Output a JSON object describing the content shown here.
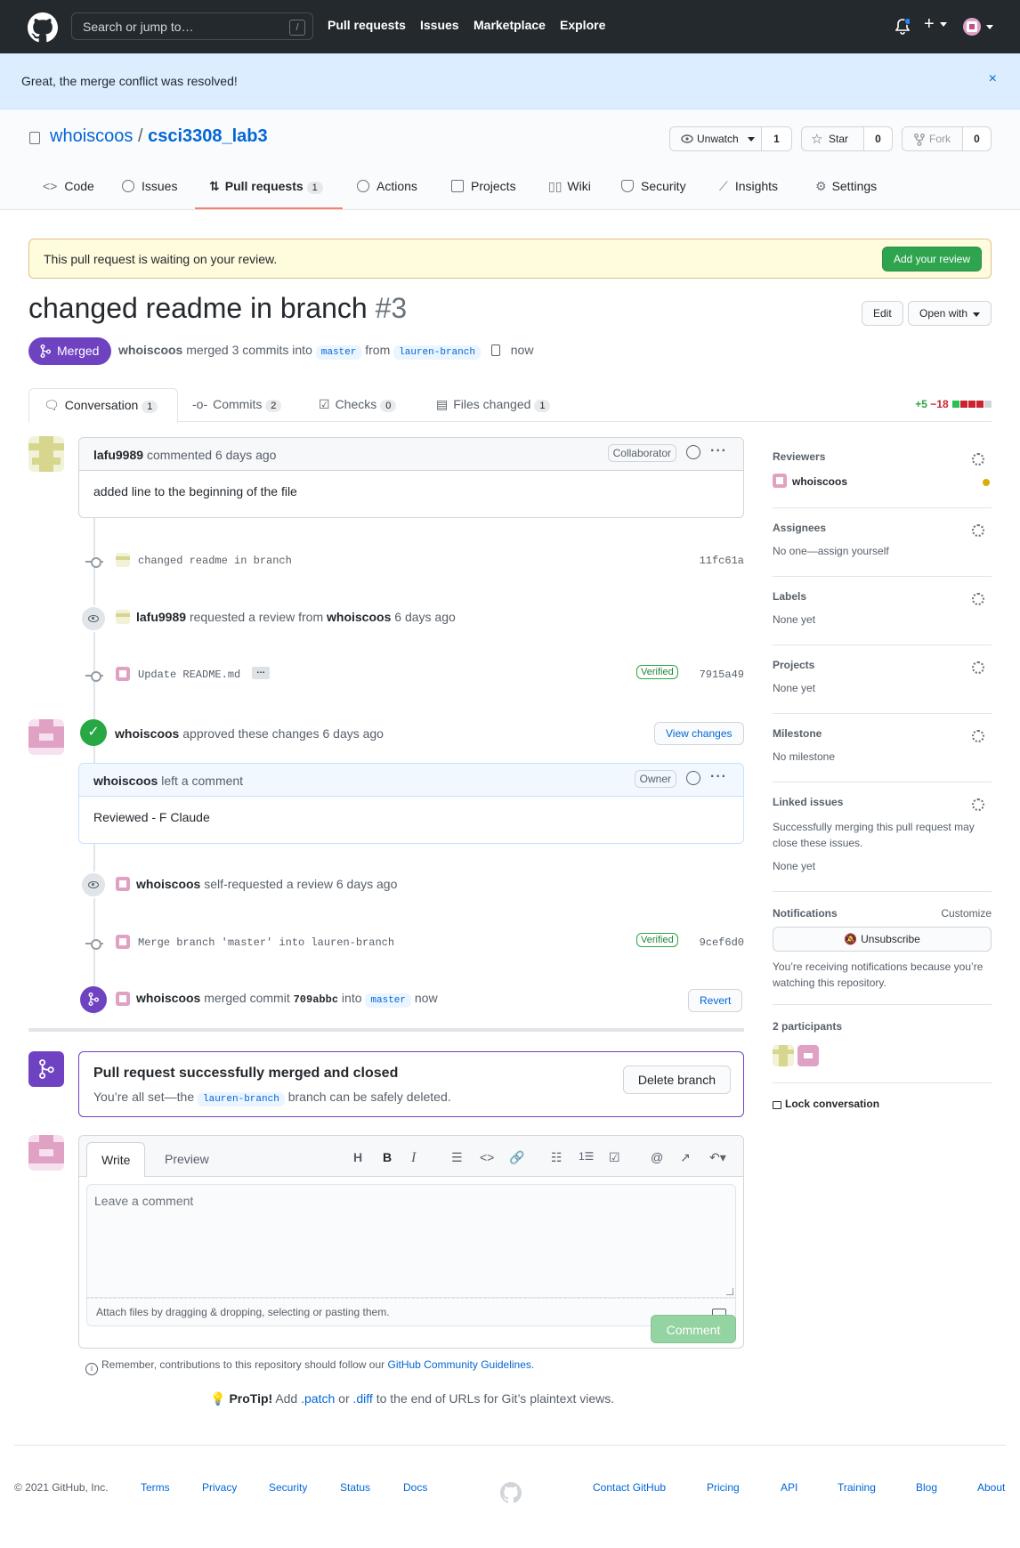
{
  "header": {
    "search_placeholder": "Search or jump to…",
    "search_key": "/",
    "nav": [
      "Pull requests",
      "Issues",
      "Marketplace",
      "Explore"
    ],
    "plus": "+"
  },
  "flash": {
    "message": "Great, the merge conflict was resolved!",
    "close": "×"
  },
  "repo": {
    "owner": "whoiscoos",
    "sep": "/",
    "name": "csci3308_lab3",
    "watch_label": "Unwatch",
    "watch_count": "1",
    "star_label": "Star",
    "star_count": "0",
    "fork_label": "Fork",
    "fork_count": "0",
    "tabs": [
      {
        "label": "Code"
      },
      {
        "label": "Issues"
      },
      {
        "label": "Pull requests",
        "count": "1"
      },
      {
        "label": "Actions"
      },
      {
        "label": "Projects"
      },
      {
        "label": "Wiki"
      },
      {
        "label": "Security"
      },
      {
        "label": "Insights"
      },
      {
        "label": "Settings"
      }
    ]
  },
  "review_banner": {
    "message": "This pull request is waiting on your review.",
    "button": "Add your review"
  },
  "pr": {
    "title": "changed readme in branch",
    "number": "#3",
    "edit": "Edit",
    "open_with": "Open with",
    "state": "Merged",
    "author": "whoiscoos",
    "meta_merged": "merged 3 commits into",
    "base": "master",
    "from": "from",
    "head": "lauren-branch",
    "time": "now",
    "tabs": [
      {
        "label": "Conversation",
        "count": "1"
      },
      {
        "label": "Commits",
        "count": "2"
      },
      {
        "label": "Checks",
        "count": "0"
      },
      {
        "label": "Files changed",
        "count": "1"
      }
    ],
    "additions": "+5",
    "deletions": "−18"
  },
  "timeline": {
    "c1": {
      "author": "lafu9989",
      "action": "commented 6 days ago",
      "role": "Collaborator",
      "body": "added line to the beginning of the file"
    },
    "commit1": {
      "message": "changed readme in branch",
      "sha": "11fc61a"
    },
    "review_req": {
      "user": "lafu9989",
      "text": "requested a review from",
      "target": "whoiscoos",
      "time": "6 days ago"
    },
    "commit2": {
      "message": "Update README.md",
      "ellipsis": "…",
      "verified": "Verified",
      "sha": "7915a49"
    },
    "approve": {
      "user": "whoiscoos",
      "text": "approved these changes 6 days ago",
      "button": "View changes"
    },
    "c2": {
      "author": "whoiscoos",
      "action": "left a comment",
      "role": "Owner",
      "body": "Reviewed - F Claude"
    },
    "selfreq": {
      "user": "whoiscoos",
      "text": "self-requested a review 6 days ago"
    },
    "commit3": {
      "message": "Merge branch 'master' into lauren-branch",
      "verified": "Verified",
      "sha": "9cef6d0"
    },
    "merged": {
      "user": "whoiscoos",
      "text": "merged commit",
      "sha": "709abbc",
      "into": "into",
      "base": "master",
      "time": "now",
      "button": "Revert"
    }
  },
  "merged_box": {
    "title": "Pull request successfully merged and closed",
    "prefix": "You’re all set—the",
    "branch": "lauren-branch",
    "suffix": "branch can be safely deleted.",
    "button": "Delete branch"
  },
  "composer": {
    "write": "Write",
    "preview": "Preview",
    "placeholder": "Leave a comment",
    "attach": "Attach files by dragging & dropping, selecting or pasting them.",
    "button": "Comment",
    "guidelines_prefix": "Remember, contributions to this repository should follow our",
    "guidelines_link": "GitHub Community Guidelines",
    "guidelines_suffix": ".",
    "protip_label": "ProTip!",
    "protip_a": "Add",
    "protip_patch": ".patch",
    "protip_or": "or",
    "protip_diff": ".diff",
    "protip_b": "to the end of URLs for Git’s plaintext views."
  },
  "sidebar": {
    "reviewers": {
      "title": "Reviewers",
      "name": "whoiscoos"
    },
    "assignees": {
      "title": "Assignees",
      "text": "No one—assign yourself"
    },
    "labels": {
      "title": "Labels",
      "text": "None yet"
    },
    "projects": {
      "title": "Projects",
      "text": "None yet"
    },
    "milestone": {
      "title": "Milestone",
      "text": "No milestone"
    },
    "linked": {
      "title": "Linked issues",
      "text": "Successfully merging this pull request may close these issues.",
      "none": "None yet"
    },
    "notifications": {
      "title": "Notifications",
      "customize": "Customize",
      "button": "Unsubscribe",
      "text": "You’re receiving notifications because you’re watching this repository."
    },
    "participants": "2 participants",
    "lock": "Lock conversation"
  },
  "footer": {
    "copyright": "© 2021 GitHub, Inc.",
    "left": [
      "Terms",
      "Privacy",
      "Security",
      "Status",
      "Docs"
    ],
    "right": [
      "Contact GitHub",
      "Pricing",
      "API",
      "Training",
      "Blog",
      "About"
    ]
  },
  "colors": {
    "merged": "#6f42c1",
    "green": "#2ea44f",
    "link": "#0366d6"
  }
}
